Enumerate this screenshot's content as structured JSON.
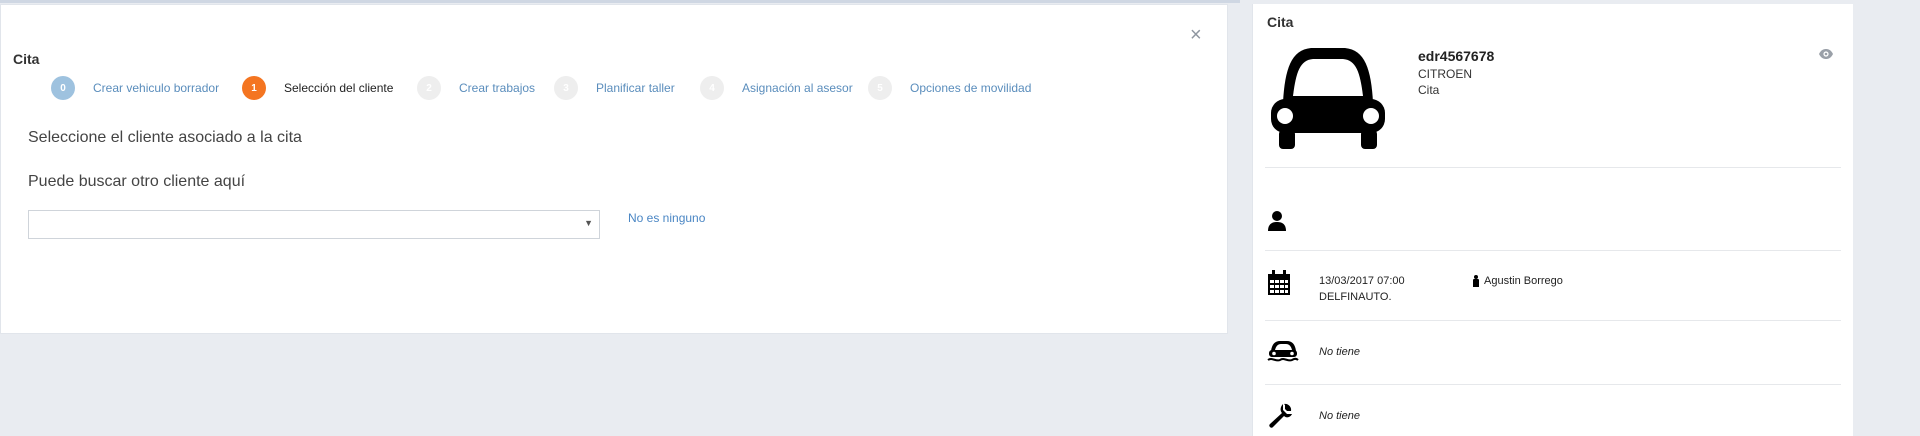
{
  "modal": {
    "title": "Cita",
    "close_label": "×",
    "steps": [
      {
        "number": "0",
        "label": "Crear vehiculo borrador",
        "state": "done"
      },
      {
        "number": "1",
        "label": "Selección del cliente",
        "state": "active"
      },
      {
        "number": "2",
        "label": "Crear trabajos",
        "state": "pending"
      },
      {
        "number": "3",
        "label": "Planificar taller",
        "state": "pending"
      },
      {
        "number": "4",
        "label": "Asignación al asesor",
        "state": "pending"
      },
      {
        "number": "5",
        "label": "Opciones de movilidad",
        "state": "pending"
      }
    ],
    "question": "Seleccione el cliente asociado a la cita",
    "search_label": "Puede buscar otro cliente aquí",
    "client_select_value": "",
    "none_link": "No es ninguno"
  },
  "panel": {
    "title": "Cita",
    "vehicle": {
      "plate": "edr4567678",
      "brand": "CITROEN",
      "type": "Cita"
    },
    "appointment": {
      "datetime": "13/03/2017 07:00",
      "workshop": "DELFINAUTO.",
      "advisor": "Agustin Borrego"
    },
    "mobility": "No tiene",
    "works": "No tiene"
  },
  "colors": {
    "accent": "#f47521",
    "link": "#4a86c4",
    "step_done": "#9ec2df",
    "step_pending": "#eeeeee",
    "background": "#e9ecf1"
  },
  "icons": [
    "close-icon",
    "caret-down-icon",
    "car-icon",
    "eye-icon",
    "user-icon",
    "calendar-icon",
    "advisor-icon",
    "car-wash-icon",
    "wrench-icon"
  ]
}
